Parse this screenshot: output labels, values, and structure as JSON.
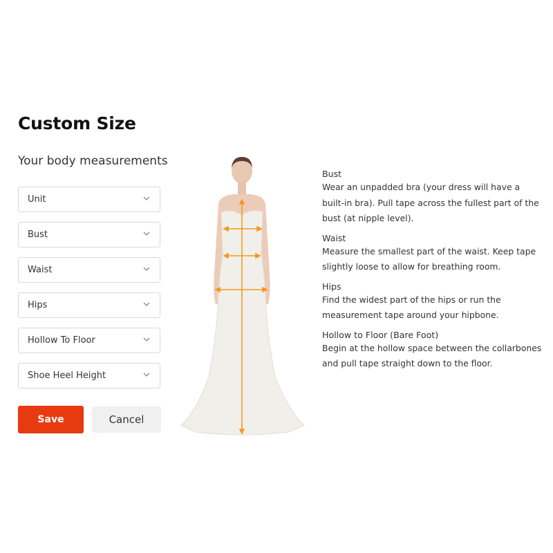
{
  "header": {
    "title": "Custom Size",
    "subtitle": "Your body measurements"
  },
  "form": {
    "fields": [
      {
        "label": "Unit",
        "icon": "chevron-down-icon"
      },
      {
        "label": "Bust",
        "icon": "chevron-down-icon"
      },
      {
        "label": "Waist",
        "icon": "chevron-down-icon"
      },
      {
        "label": "Hips",
        "icon": "chevron-down-icon"
      },
      {
        "label": "Hollow To Floor",
        "icon": "chevron-down-icon"
      },
      {
        "label": "Shoe Heel Height",
        "icon": "chevron-down-icon"
      }
    ],
    "save_label": "Save",
    "cancel_label": "Cancel"
  },
  "colors": {
    "accent": "#e83a10",
    "measure_line": "#f39a1e",
    "cancel_bg": "#f0f0f0"
  },
  "figure": {
    "description": "Model in white lace strapless mermaid gown with measurement guide lines",
    "measure_lines": [
      "bust",
      "waist",
      "hips",
      "hollow-to-floor"
    ]
  },
  "guide": [
    {
      "heading": "Bust",
      "text": "Wear an unpadded bra (your dress will have a built-in bra). Pull tape across the fullest part of the bust (at nipple level)."
    },
    {
      "heading": "Waist",
      "text": "Measure the smallest part of the waist. Keep tape slightly loose to allow for breathing room."
    },
    {
      "heading": "Hips",
      "text": "Find the widest part of the hips or run the measurement tape around your hipbone."
    },
    {
      "heading": "Hollow to Floor (Bare Foot)",
      "text": "Begin at the hollow space between the collarbones and pull tape straight down to the floor."
    }
  ]
}
